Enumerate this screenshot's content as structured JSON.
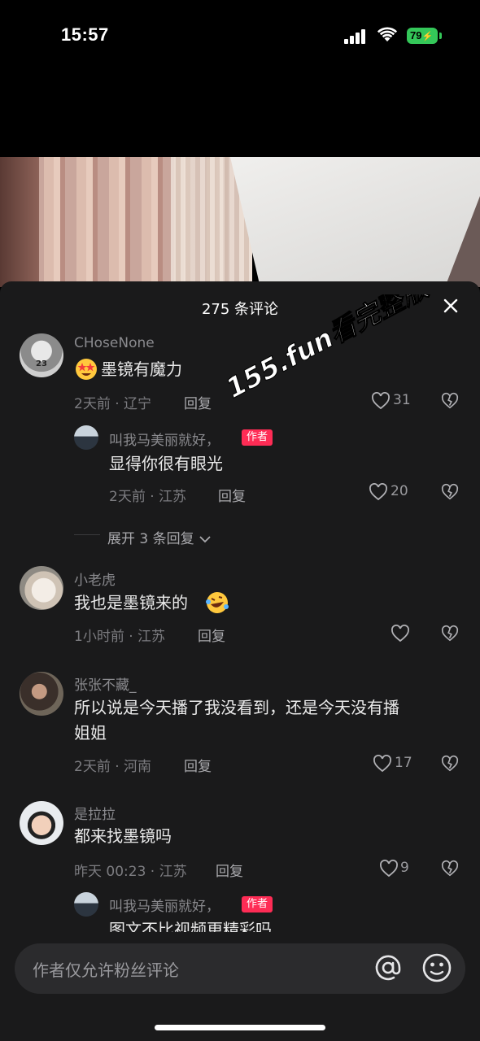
{
  "status_bar": {
    "time": "15:57",
    "battery": "79"
  },
  "panel": {
    "title": "275 条评论",
    "watermark": "155.fun看完整版"
  },
  "comments": [
    {
      "name": "CHoseNone",
      "text": "墨镜有魔力",
      "emoji": "star-struck-emoji",
      "meta": "2天前 · 辽宁",
      "reply": "回复",
      "likes": "31"
    },
    {
      "name": "小老虎",
      "text": "我也是墨镜来的",
      "emoji": "rolling-laugh-emoji",
      "meta": "1小时前 · 江苏",
      "reply": "回复",
      "likes": ""
    },
    {
      "name": "张张不藏_",
      "text_line1": "所以说是今天播了我没看到，还是今天没有播",
      "text_line2": "姐姐",
      "meta": "2天前 · 河南",
      "reply": "回复",
      "likes": "17"
    },
    {
      "name": "是拉拉",
      "text": "都来找墨镜吗",
      "meta": "昨天 00:23 · 江苏",
      "reply": "回复",
      "likes": "9"
    }
  ],
  "replies": [
    {
      "name": "叫我马美丽就好，",
      "tag": "作者",
      "text": "显得你很有眼光",
      "meta": "2天前 · 江苏",
      "reply": "回复",
      "likes": "20"
    },
    {
      "name": "叫我马美丽就好，",
      "tag": "作者",
      "text": "图文不比视频更精彩吗"
    }
  ],
  "expand_replies": "展开 3 条回复",
  "input": {
    "placeholder": "作者仅允许粉丝评论"
  },
  "colors": {
    "panel_bg": "#1a1a1b",
    "author_tag": "#fe2c55",
    "battery": "#34c759"
  }
}
